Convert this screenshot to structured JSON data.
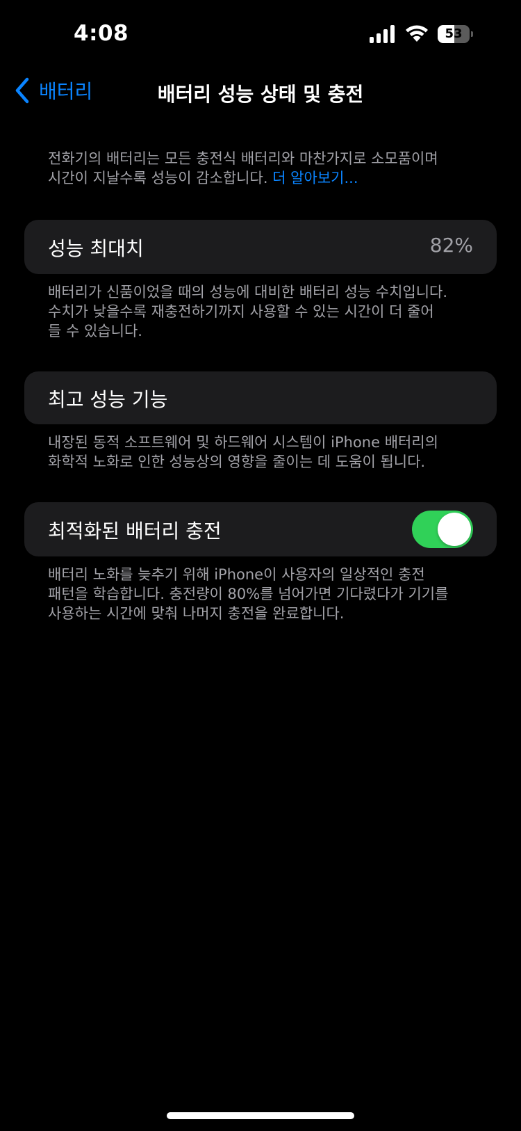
{
  "status": {
    "time": "4:08",
    "battery_percent": "53",
    "battery_level": 0.53,
    "signal_bars": 4
  },
  "nav": {
    "back_label": "배터리",
    "title": "배터리 성능 상태 및 충전"
  },
  "intro": {
    "text_line1": "전화기의 배터리는 모든 충전식 배터리와 마찬가지로 소모품이며",
    "text_line2": "시간이 지날수록 성능이 감소합니다. ",
    "learn_more": "더 알아보기..."
  },
  "max_capacity": {
    "label": "성능 최대치",
    "value": "82%",
    "desc_line1": "배터리가 신품이었을 때의 성능에 대비한 배터리 성능 수치입니다.",
    "desc_line2": "수치가 낮을수록 재충전하기까지 사용할 수 있는 시간이 더 줄어",
    "desc_line3": "들 수 있습니다."
  },
  "peak_performance": {
    "label": "최고 성능 기능",
    "desc_line1": "내장된 동적 소프트웨어 및 하드웨어 시스템이 iPhone 배터리의",
    "desc_line2": "화학적 노화로 인한 성능상의 영향을 줄이는 데 도움이 됩니다."
  },
  "optimized_charging": {
    "label": "최적화된 배터리 충전",
    "enabled": true,
    "desc_line1": "배터리 노화를 늦추기 위해 iPhone이 사용자의 일상적인 충전",
    "desc_line2": "패턴을 학습합니다. 충전량이 80%를 넘어가면 기다렸다가 기기를",
    "desc_line3": "사용하는 시간에 맞춰 나머지 충전을 완료합니다."
  },
  "colors": {
    "background": "#000000",
    "card": "#1c1c1e",
    "accent": "#0a84ff",
    "toggle_on": "#30d158",
    "secondary_text": "#a2a2a8"
  },
  "icons": [
    "signal-icon",
    "wifi-icon",
    "battery-icon",
    "chevron-left-icon"
  ]
}
